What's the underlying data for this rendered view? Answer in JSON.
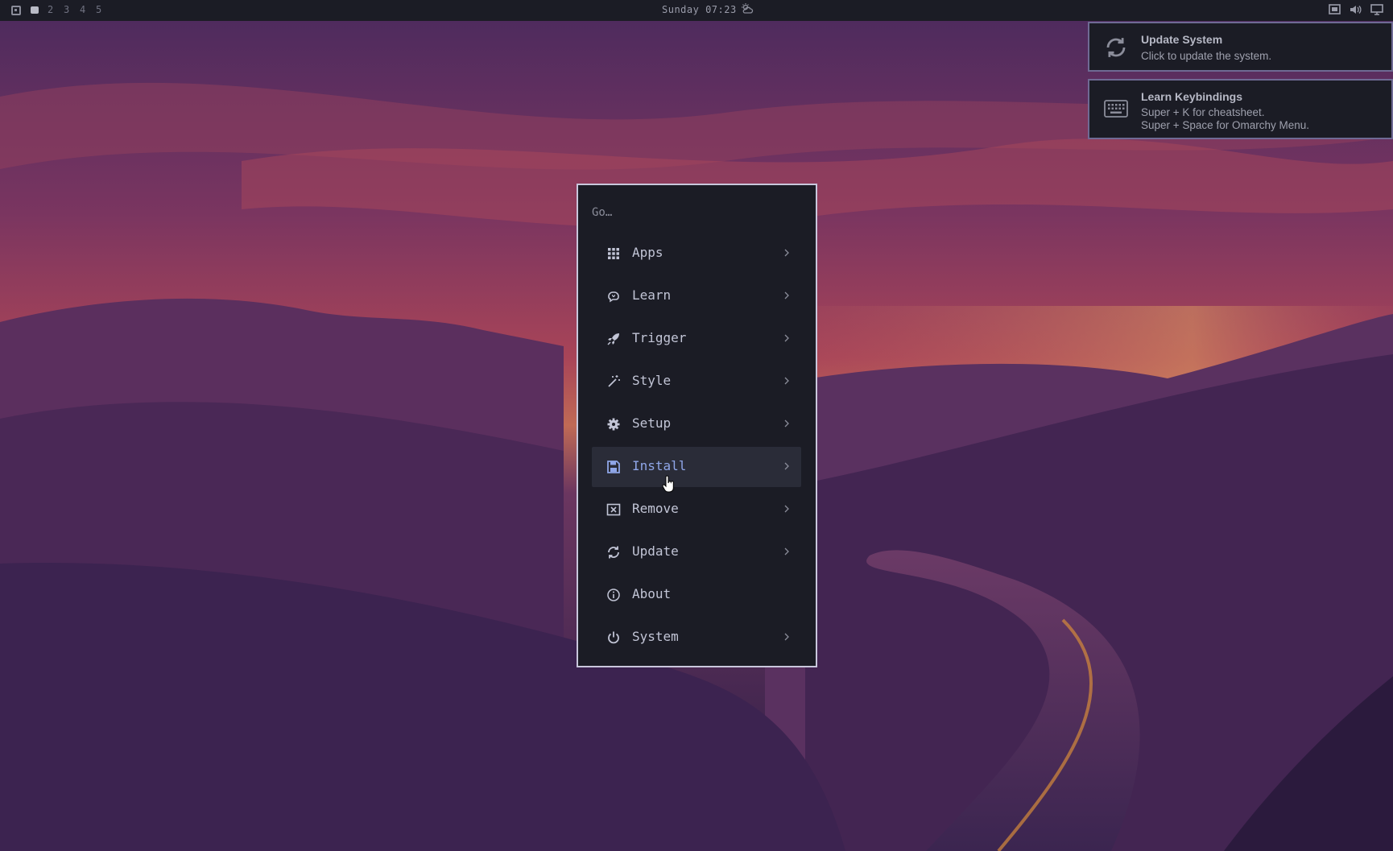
{
  "topbar": {
    "workspaces": [
      "2",
      "3",
      "4",
      "5"
    ],
    "clock": "Sunday 07:23",
    "weather_icon": "cloud-sun-icon",
    "tray_icons": [
      "screen-record-icon",
      "volume-icon",
      "display-icon"
    ]
  },
  "notifications": [
    {
      "title": "Update System",
      "body": "Click to update the system.",
      "icon": "refresh-icon"
    },
    {
      "title": "Learn Keybindings",
      "body_lines": [
        "Super + K for cheatsheet.",
        "Super + Space for Omarchy Menu."
      ],
      "icon": "keyboard-icon"
    }
  ],
  "menu": {
    "search_placeholder": "Go…",
    "items": [
      {
        "label": "Apps",
        "icon": "grid-icon",
        "has_submenu": true
      },
      {
        "label": "Learn",
        "icon": "brain-icon",
        "has_submenu": true
      },
      {
        "label": "Trigger",
        "icon": "rocket-icon",
        "has_submenu": true
      },
      {
        "label": "Style",
        "icon": "magic-wand-icon",
        "has_submenu": true
      },
      {
        "label": "Setup",
        "icon": "gear-icon",
        "has_submenu": true
      },
      {
        "label": "Install",
        "icon": "floppy-icon",
        "has_submenu": true,
        "active": true
      },
      {
        "label": "Remove",
        "icon": "remove-box-icon",
        "has_submenu": true
      },
      {
        "label": "Update",
        "icon": "refresh-icon",
        "has_submenu": true
      },
      {
        "label": "About",
        "icon": "info-icon",
        "has_submenu": false
      },
      {
        "label": "System",
        "icon": "power-icon",
        "has_submenu": true
      }
    ]
  },
  "colors": {
    "bar_bg": "#1b1c25",
    "menu_border": "#c9c7dc",
    "active_item_text": "#8fa6e8",
    "notification_border": "#6f6a94"
  }
}
